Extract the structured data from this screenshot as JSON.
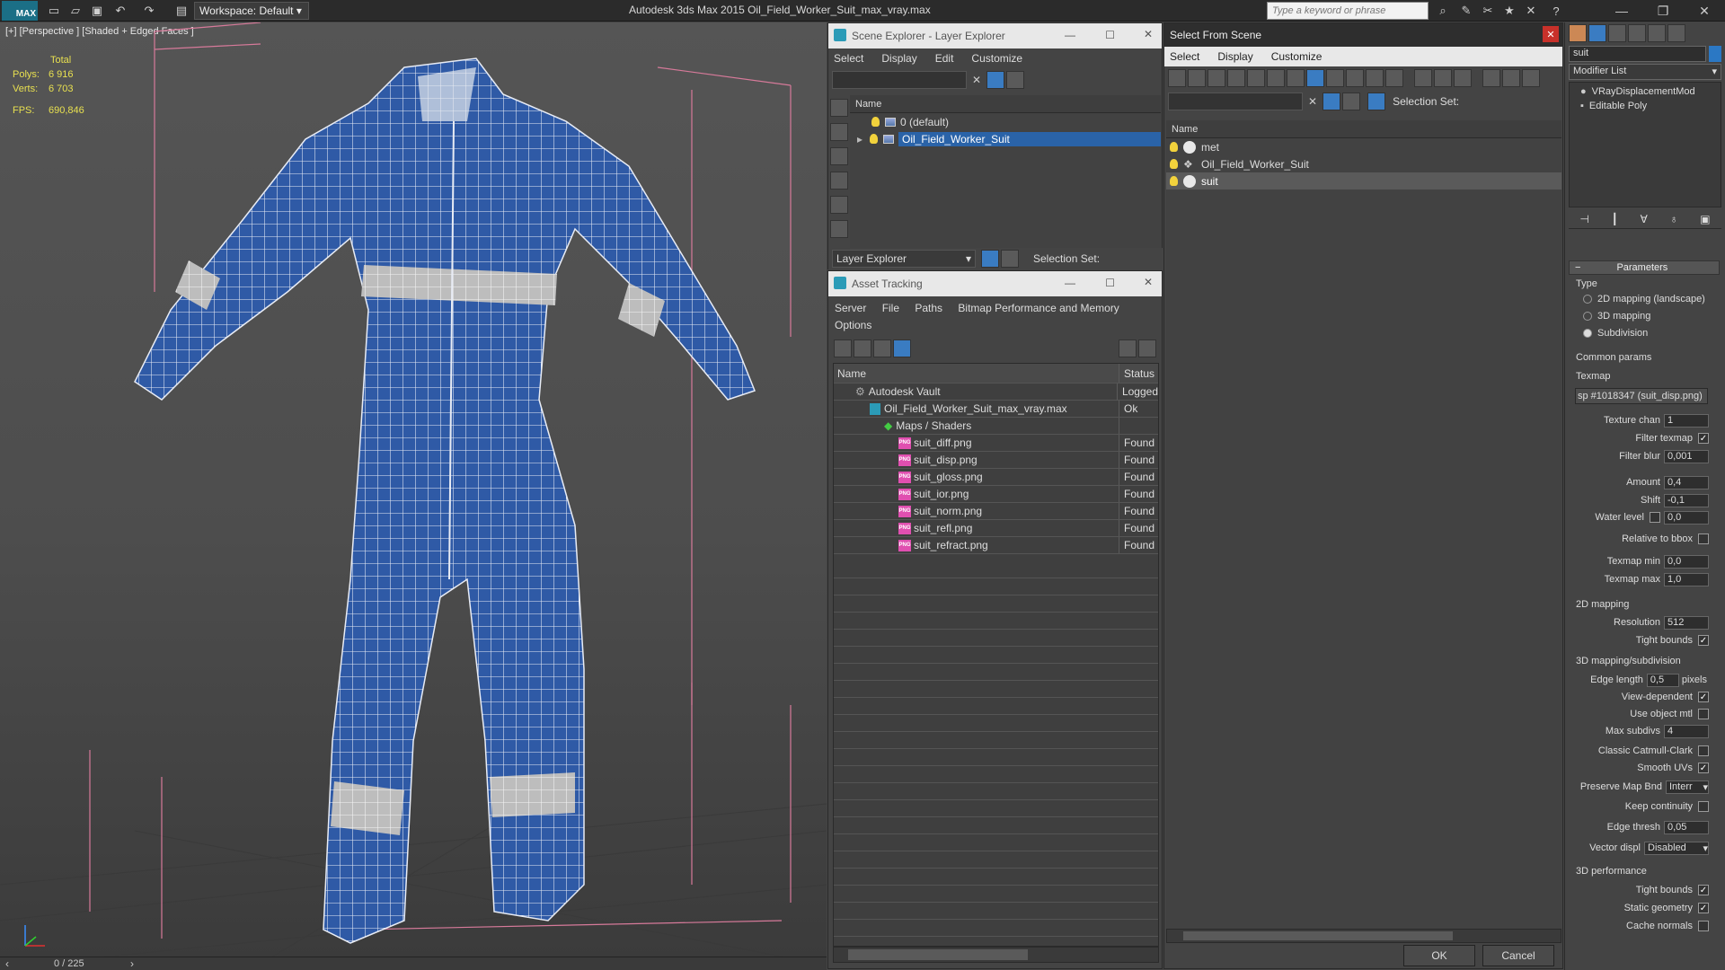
{
  "titlebar": {
    "logo_text": "MAX",
    "workspace": "Workspace: Default",
    "app_title": "Autodesk 3ds Max  2015    Oil_Field_Worker_Suit_max_vray.max",
    "search_placeholder": "Type a keyword or phrase"
  },
  "viewport": {
    "label": "[+] [Perspective ] [Shaded + Edged Faces ]",
    "stats": {
      "total_label": "Total",
      "polys_label": "Polys:",
      "polys": "6 916",
      "verts_label": "Verts:",
      "verts": "6 703",
      "fps_label": "FPS:",
      "fps": "690,846"
    },
    "frames": "0 / 225",
    "suit_color": "#2f5aa6",
    "band_color": "#bdbdbd"
  },
  "scene_explorer": {
    "title": "Scene Explorer - Layer Explorer",
    "menu": [
      "Select",
      "Display",
      "Edit",
      "Customize"
    ],
    "column": "Name",
    "rows": [
      "0 (default)",
      "Oil_Field_Worker_Suit"
    ],
    "footer_mode": "Layer Explorer",
    "selection_set": "Selection Set:"
  },
  "asset_tracking": {
    "title": "Asset Tracking",
    "menu": [
      "Server",
      "File",
      "Paths",
      "Bitmap Performance and Memory",
      "Options"
    ],
    "col_name": "Name",
    "col_status": "Status",
    "rows": [
      {
        "name": "Autodesk Vault",
        "status": "Logged"
      },
      {
        "name": "Oil_Field_Worker_Suit_max_vray.max",
        "status": "Ok"
      },
      {
        "name": "Maps / Shaders",
        "status": ""
      },
      {
        "name": "suit_diff.png",
        "status": "Found"
      },
      {
        "name": "suit_disp.png",
        "status": "Found"
      },
      {
        "name": "suit_gloss.png",
        "status": "Found"
      },
      {
        "name": "suit_ior.png",
        "status": "Found"
      },
      {
        "name": "suit_norm.png",
        "status": "Found"
      },
      {
        "name": "suit_refl.png",
        "status": "Found"
      },
      {
        "name": "suit_refract.png",
        "status": "Found"
      }
    ],
    "png_badge": "PNG"
  },
  "select_from_scene": {
    "title": "Select From Scene",
    "menu": [
      "Select",
      "Display",
      "Customize"
    ],
    "selection_set": "Selection Set:",
    "column": "Name",
    "rows": [
      "met",
      "Oil_Field_Worker_Suit",
      "suit"
    ],
    "ok": "OK",
    "cancel": "Cancel"
  },
  "command_panel": {
    "object_name": "suit",
    "modifier_list": "Modifier List",
    "stack": [
      "VRayDisplacementMod",
      "Editable Poly"
    ],
    "parameters": "Parameters",
    "type_label": "Type",
    "type_options": [
      "2D mapping (landscape)",
      "3D mapping",
      "Subdivision"
    ],
    "common_params": "Common params",
    "texmap_label": "Texmap",
    "texmap_value": "sp #1018347 (suit_disp.png)",
    "texture_chan_label": "Texture chan",
    "texture_chan": "1",
    "filter_texmap": "Filter texmap",
    "filter_blur_label": "Filter blur",
    "filter_blur": "0,001",
    "amount_label": "Amount",
    "amount": "0,4",
    "shift_label": "Shift",
    "shift": "-0,1",
    "water_level_label": "Water level",
    "water_level": "0,0",
    "relative_bbox": "Relative to bbox",
    "texmap_min_label": "Texmap min",
    "texmap_min": "0,0",
    "texmap_max_label": "Texmap max",
    "texmap_max": "1,0",
    "mapping_2d": "2D mapping",
    "resolution_label": "Resolution",
    "resolution": "512",
    "tight_bounds": "Tight bounds",
    "mapping_3d": "3D mapping/subdivision",
    "edge_length_label": "Edge length",
    "edge_length": "0,5",
    "pixels": "pixels",
    "view_dependent": "View-dependent",
    "use_object_mtl": "Use object mtl",
    "max_subdivs_label": "Max subdivs",
    "max_subdivs": "4",
    "classic_catmull": "Classic Catmull-Clark",
    "smooth_uvs": "Smooth UVs",
    "preserve_map_label": "Preserve Map Bnd",
    "preserve_map": "Interr",
    "keep_continuity": "Keep continuity",
    "edge_thresh_label": "Edge thresh",
    "edge_thresh": "0,05",
    "vector_displ_label": "Vector displ",
    "vector_displ": "Disabled",
    "perf_3d": "3D performance",
    "tight_bounds2": "Tight bounds",
    "static_geometry": "Static geometry",
    "cache_normals": "Cache normals"
  }
}
